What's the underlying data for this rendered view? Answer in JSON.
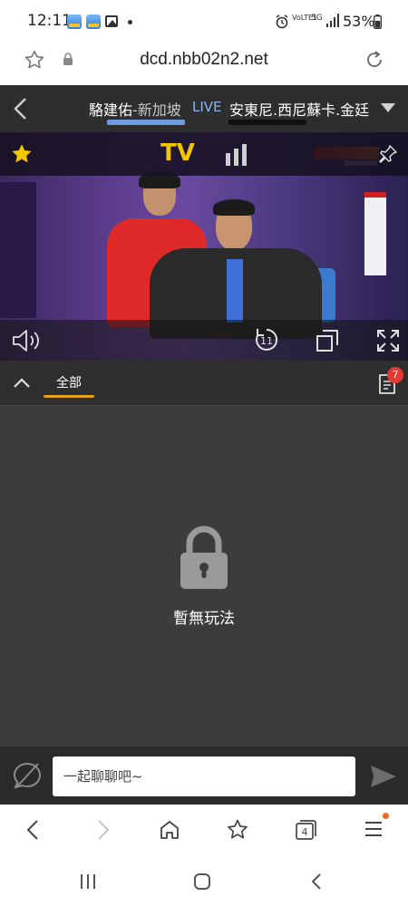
{
  "status_bar": {
    "time": "12:11",
    "network_top": "VoLTE1",
    "network_5g": "5G",
    "battery": "53%"
  },
  "browser": {
    "url": "dcd.nbb02n2.net"
  },
  "match": {
    "player_a": "駱建佑",
    "player_a_country": "-新加坡",
    "live_label": "LIVE",
    "player_b": "安東尼.西尼蘇卡.金廷"
  },
  "video": {
    "tv_label": "TV",
    "replay_seconds": "11"
  },
  "tabs": {
    "all_label": "全部",
    "notification_count": "7"
  },
  "empty_state": {
    "message": "暫無玩法"
  },
  "chat": {
    "placeholder": "一起聊聊吧~"
  },
  "browser_bar": {
    "tab_count": "4"
  },
  "colors": {
    "accent": "#e8a317",
    "tv_yellow": "#f3c400",
    "live_blue": "#8ab4f0",
    "badge_red": "#e53935"
  }
}
